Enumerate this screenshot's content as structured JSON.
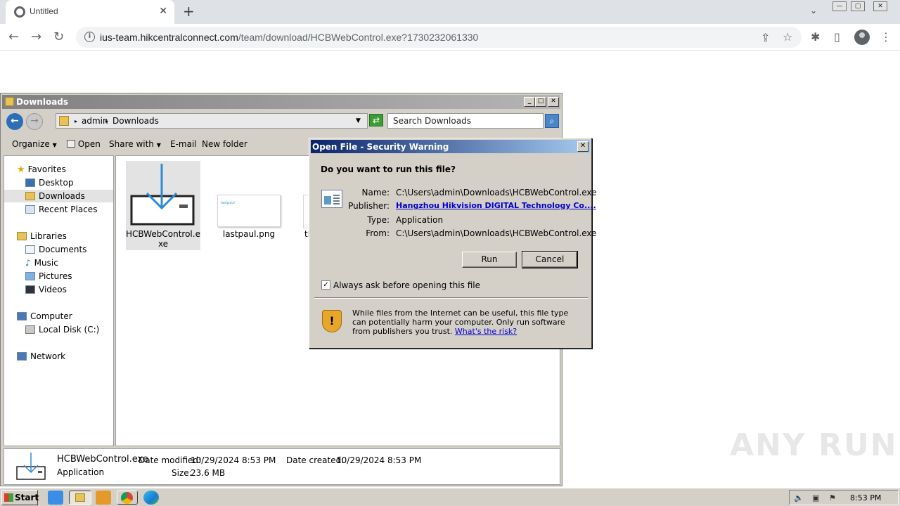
{
  "browser": {
    "tab_title": "Untitled",
    "tab_close": "✕",
    "new_tab": "+",
    "tab_search": "⌄",
    "url_domain": "ius-team.hikcentralconnect.com",
    "url_path": "/team/download/HCBWebControl.exe?1730232061330",
    "back": "←",
    "forward": "→",
    "reload": "↻",
    "share_icon": "⇪",
    "star_icon": "☆",
    "extensions_icon": "✱",
    "sidepanel_icon": "▯",
    "menu_icon": "⋮"
  },
  "explorer": {
    "title": "Downloads",
    "breadcrumb": [
      "admin",
      "Downloads"
    ],
    "search_placeholder": "Search Downloads",
    "commands": [
      "Organize",
      "Open",
      "Share with",
      "E-mail",
      "New folder"
    ],
    "nav": {
      "favorites": "Favorites",
      "desktop": "Desktop",
      "downloads": "Downloads",
      "recent": "Recent Places",
      "libraries": "Libraries",
      "documents": "Documents",
      "music": "Music",
      "pictures": "Pictures",
      "videos": "Videos",
      "computer": "Computer",
      "local_disk": "Local Disk (C:)",
      "network": "Network"
    },
    "files": [
      {
        "name": "HCBWebControl.exe",
        "selected": true
      },
      {
        "name": "lastpaul.png",
        "thumb_text": "lastpaul"
      },
      {
        "name": "th"
      }
    ],
    "details": {
      "name": "HCBWebControl.exe",
      "type": "Application",
      "date_modified_label": "Date modified:",
      "date_modified": "10/29/2024 8:53 PM",
      "date_created_label": "Date created:",
      "date_created": "10/29/2024 8:53 PM",
      "size_label": "Size:",
      "size": "23.6 MB"
    }
  },
  "dialog": {
    "title": "Open File - Security Warning",
    "question": "Do you want to run this file?",
    "name_label": "Name:",
    "name_value": "C:\\Users\\admin\\Downloads\\HCBWebControl.exe",
    "publisher_label": "Publisher:",
    "publisher_value": "Hangzhou Hikvision DIGITAL Technology Co....",
    "type_label": "Type:",
    "type_value": "Application",
    "from_label": "From:",
    "from_value": "C:\\Users\\admin\\Downloads\\HCBWebControl.exe",
    "run_label": "Run",
    "cancel_label": "Cancel",
    "always_ask_label": "Always ask before opening this file",
    "always_ask_checked": true,
    "warning_text": "While files from the Internet can be useful, this file type can potentially harm your computer. Only run software from publishers you trust.",
    "risk_link": "What's the risk?"
  },
  "taskbar": {
    "start_label": "Start",
    "clock": "8:53 PM"
  },
  "watermark": "ANY RUN"
}
